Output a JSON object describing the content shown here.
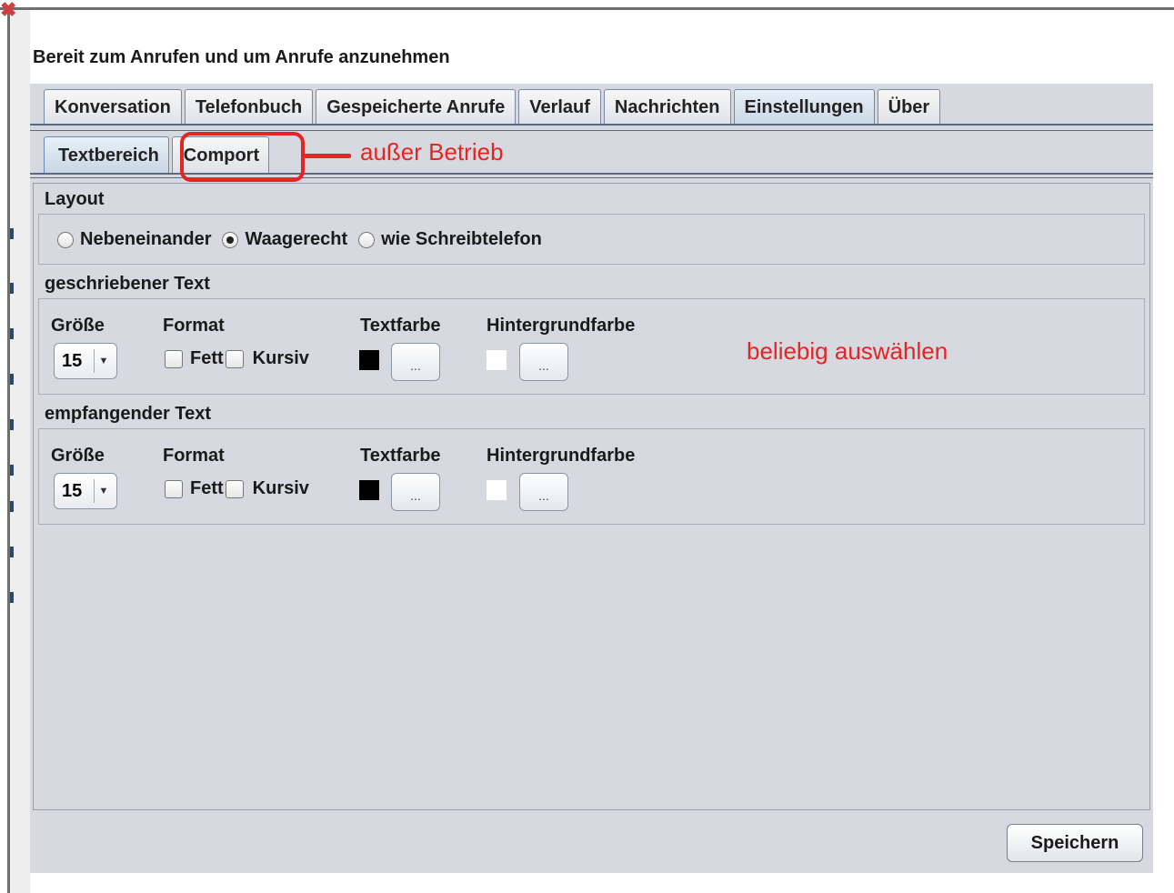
{
  "status": "Bereit zum Anrufen und um Anrufe anzunehmen",
  "tabs": [
    "Konversation",
    "Telefonbuch",
    "Gespeicherte Anrufe",
    "Verlauf",
    "Nachrichten",
    "Einstellungen",
    "Über"
  ],
  "active_tab": "Einstellungen",
  "subtabs": [
    "Textbereich",
    "Comport"
  ],
  "active_subtab": "Textbereich",
  "layout": {
    "title": "Layout",
    "options": [
      "Nebeneinander",
      "Waagerecht",
      "wie Schreibtelefon"
    ],
    "selected": "Waagerecht"
  },
  "written": {
    "title": "geschriebener Text",
    "size_label": "Größe",
    "size_value": "15",
    "format_label": "Format",
    "bold_label": "Fett",
    "italic_label": "Kursiv",
    "bold_checked": false,
    "italic_checked": false,
    "textcolor_label": "Textfarbe",
    "textcolor": "#000000",
    "bgcolor_label": "Hintergrundfarbe",
    "bgcolor": "#ffffff",
    "picker_label": "..."
  },
  "received": {
    "title": "empfangender Text",
    "size_label": "Größe",
    "size_value": "15",
    "format_label": "Format",
    "bold_label": "Fett",
    "italic_label": "Kursiv",
    "bold_checked": false,
    "italic_checked": false,
    "textcolor_label": "Textfarbe",
    "textcolor": "#000000",
    "bgcolor_label": "Hintergrundfarbe",
    "bgcolor": "#ffffff",
    "picker_label": "..."
  },
  "save_label": "Speichern",
  "annotations": {
    "comport_note": "außer Betrieb",
    "color_note": "beliebig auswählen",
    "color": "#e52424"
  }
}
